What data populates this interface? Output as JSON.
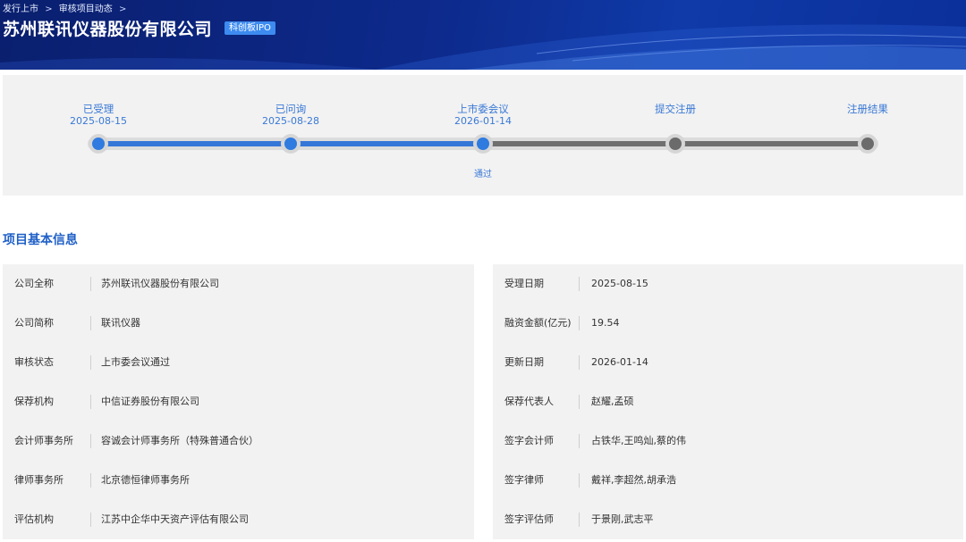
{
  "header": {
    "breadcrumb": [
      "发行上市",
      "审核项目动态"
    ],
    "breadcrumb_sep": ">",
    "title": "苏州联讯仪器股份有限公司",
    "badge": "科创板IPO"
  },
  "progress": {
    "stages": [
      {
        "label": "已受理",
        "date": "2025-08-15",
        "status": "done"
      },
      {
        "label": "已问询",
        "date": "2025-08-28",
        "status": "done"
      },
      {
        "label": "上市委会议",
        "date": "2026-01-14",
        "status": "done",
        "result": "通过"
      },
      {
        "label": "提交注册",
        "date": "",
        "status": "todo"
      },
      {
        "label": "注册结果",
        "date": "",
        "status": "todo"
      }
    ]
  },
  "section": {
    "title": "项目基本信息"
  },
  "info": {
    "left": [
      {
        "key": "公司全称",
        "value": "苏州联讯仪器股份有限公司"
      },
      {
        "key": "公司简称",
        "value": "联讯仪器"
      },
      {
        "key": "审核状态",
        "value": "上市委会议通过"
      },
      {
        "key": "保荐机构",
        "value": "中信证券股份有限公司"
      },
      {
        "key": "会计师事务所",
        "value": "容诚会计师事务所（特殊普通合伙）"
      },
      {
        "key": "律师事务所",
        "value": "北京德恒律师事务所"
      },
      {
        "key": "评估机构",
        "value": "江苏中企华中天资产评估有限公司"
      }
    ],
    "right": [
      {
        "key": "受理日期",
        "value": "2025-08-15"
      },
      {
        "key": "融资金额(亿元)",
        "value": "19.54"
      },
      {
        "key": "更新日期",
        "value": "2026-01-14"
      },
      {
        "key": "保荐代表人",
        "value": "赵耀,孟硕"
      },
      {
        "key": "签字会计师",
        "value": "占铁华,王鸣灿,蔡的伟"
      },
      {
        "key": "签字律师",
        "value": "戴祥,李超然,胡承浩"
      },
      {
        "key": "签字评估师",
        "value": "于景刚,武志平"
      }
    ]
  },
  "colors": {
    "accent": "#2f7be0",
    "header_bg": "#0d2a8c",
    "pending": "#6b6b6b"
  }
}
